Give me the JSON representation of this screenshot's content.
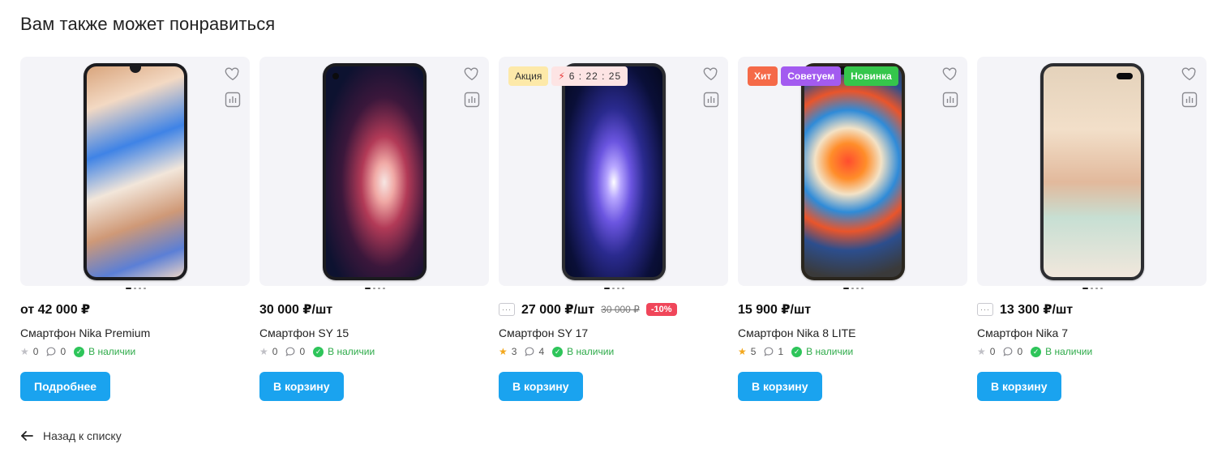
{
  "section_title": "Вам также может понравиться",
  "back_link": "Назад к списку",
  "products": [
    {
      "name": "Смартфон Nika Premium",
      "price": "от 42 000 ₽",
      "old_price": "",
      "discount": "",
      "badges": [],
      "rating": "0",
      "rating_active": false,
      "comments": "0",
      "availability": "В наличии",
      "button": "Подробнее",
      "show_more_icon": false
    },
    {
      "name": "Смартфон SY 15",
      "price": "30 000 ₽/шт",
      "old_price": "",
      "discount": "",
      "badges": [],
      "rating": "0",
      "rating_active": false,
      "comments": "0",
      "availability": "В наличии",
      "button": "В корзину",
      "show_more_icon": false
    },
    {
      "name": "Смартфон SY 17",
      "price": "27 000 ₽/шт",
      "old_price": "30 000 ₽",
      "discount": "-10%",
      "badges": [
        {
          "type": "promo",
          "label": "Акция"
        },
        {
          "type": "timer",
          "label": "6 : 22 : 25"
        }
      ],
      "rating": "3",
      "rating_active": true,
      "comments": "4",
      "availability": "В наличии",
      "button": "В корзину",
      "show_more_icon": true
    },
    {
      "name": "Смартфон Nika 8 LITE",
      "price": "15 900 ₽/шт",
      "old_price": "",
      "discount": "",
      "badges": [
        {
          "type": "hit",
          "label": "Хит"
        },
        {
          "type": "advise",
          "label": "Советуем"
        },
        {
          "type": "new",
          "label": "Новинка"
        }
      ],
      "rating": "5",
      "rating_active": true,
      "comments": "1",
      "availability": "В наличии",
      "button": "В корзину",
      "show_more_icon": false
    },
    {
      "name": "Смартфон Nika 7",
      "price": "13 300 ₽/шт",
      "old_price": "",
      "discount": "",
      "badges": [],
      "rating": "0",
      "rating_active": false,
      "comments": "0",
      "availability": "В наличии",
      "button": "В корзину",
      "show_more_icon": true
    }
  ],
  "icons": {
    "favorite": "heart-icon",
    "compare": "compare-icon",
    "back": "arrow-left-icon",
    "more": "ellipsis-icon",
    "rating": "star-icon",
    "comments": "comment-icon",
    "availability": "check-circle-icon"
  },
  "colors": {
    "button": "#1aa3ef",
    "discount": "#f0465a",
    "hit": "#f56a48",
    "advise": "#a35bf0",
    "new": "#35c64b",
    "promo": "#fde9a9",
    "availability": "#2eab4a"
  }
}
